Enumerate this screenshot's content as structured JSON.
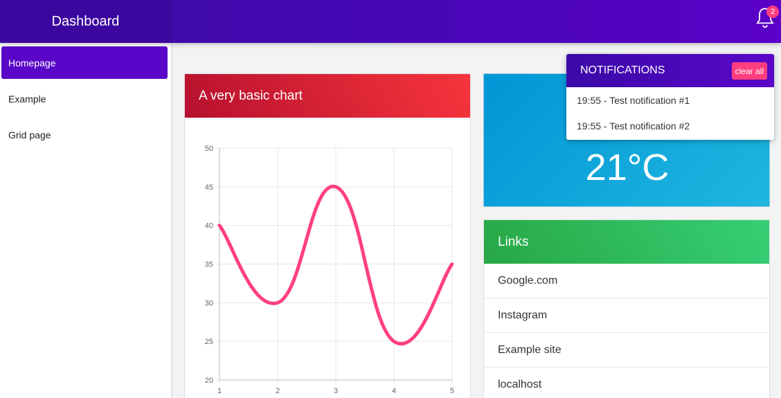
{
  "header": {
    "brand": "Dashboard",
    "notification_count": "2",
    "bell_icon": "bell-icon"
  },
  "sidebar": {
    "items": [
      {
        "label": "Homepage",
        "active": true
      },
      {
        "label": "Example",
        "active": false
      },
      {
        "label": "Grid page",
        "active": false
      }
    ]
  },
  "chart_card": {
    "title": "A very basic chart"
  },
  "chart_data": {
    "type": "line",
    "x": [
      1,
      2,
      3,
      4,
      5
    ],
    "series": [
      {
        "values": [
          40,
          30,
          45,
          25,
          35
        ],
        "color": "#ff4081"
      }
    ],
    "title": "",
    "xlabel": "",
    "ylabel": "",
    "xlim": [
      1,
      5
    ],
    "ylim": [
      20,
      50
    ],
    "yticks": [
      20,
      25,
      30,
      35,
      40,
      45,
      50
    ],
    "xticks": [
      1,
      2,
      3,
      4,
      5
    ],
    "grid": true,
    "smooth": true
  },
  "weather_card": {
    "temperature": "21°C"
  },
  "links_card": {
    "title": "Links",
    "items": [
      "Google.com",
      "Instagram",
      "Example site",
      "localhost"
    ]
  },
  "notifications": {
    "title": "NOTIFICATIONS",
    "clear_label": "clear all",
    "items": [
      "19:55 - Test notification #1",
      "19:55 - Test notification #2"
    ]
  },
  "colors": {
    "topbar": "#4a06b8",
    "accent": "#5a06c8",
    "badge": "#ff3d7f",
    "chart_header": "#e02a3a",
    "weather": "#0fa3d9",
    "links_header": "#2fbf63"
  }
}
